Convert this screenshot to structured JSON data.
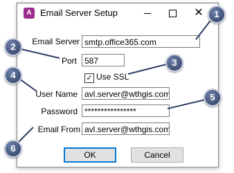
{
  "window": {
    "title": "Email Server Setup",
    "icon_text": "A",
    "controls": {
      "minimize": "—",
      "maximize": "□",
      "close": "✕"
    }
  },
  "form": {
    "email_server_label": "Email Server",
    "email_server_value": "smtp.office365.com",
    "port_label": "Port",
    "port_value": "587",
    "use_ssl_label": "Use SSL",
    "use_ssl_checked": "✓",
    "user_name_label": "User Name",
    "user_name_value": "avl.server@wthgis.com",
    "password_label": "Password",
    "password_value": "****************",
    "email_from_label": "Email From",
    "email_from_value": "avl.server@wthgis.com"
  },
  "buttons": {
    "ok": "OK",
    "cancel": "Cancel"
  },
  "callouts": [
    "1",
    "2",
    "3",
    "4",
    "5",
    "6"
  ]
}
